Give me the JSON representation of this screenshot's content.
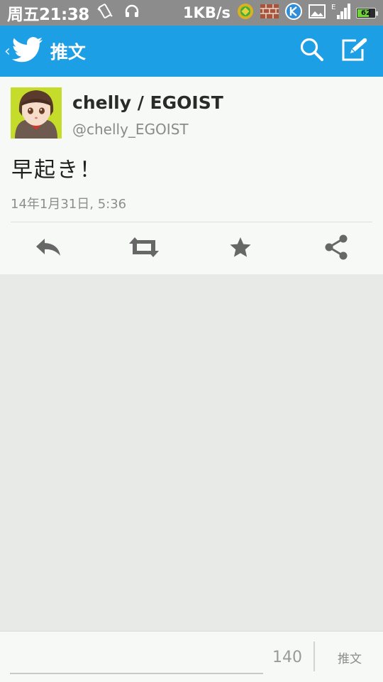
{
  "status_bar": {
    "time": "周五21:38",
    "net_speed": "1KB/s",
    "battery_level": 0.62,
    "battery_label": "62",
    "icons": [
      "vibrate-icon",
      "headset-icon",
      "app-notify-icon",
      "brick-icon",
      "k-icon",
      "image-icon",
      "signal-icon"
    ]
  },
  "app_bar": {
    "back_label": "‹",
    "title": "推文",
    "brand_color": "#1d9fe6",
    "actions": [
      "search-icon",
      "compose-icon"
    ]
  },
  "tweet": {
    "display_name": "chelly / EGOIST",
    "handle": "@chelly_EGOIST",
    "text": "早起き！",
    "timestamp": "14年1月31日, 5:36",
    "actions": [
      "reply-icon",
      "retweet-icon",
      "favorite-icon",
      "share-icon"
    ]
  },
  "composer": {
    "placeholder": "",
    "char_count": "140",
    "submit_label": "推文"
  }
}
